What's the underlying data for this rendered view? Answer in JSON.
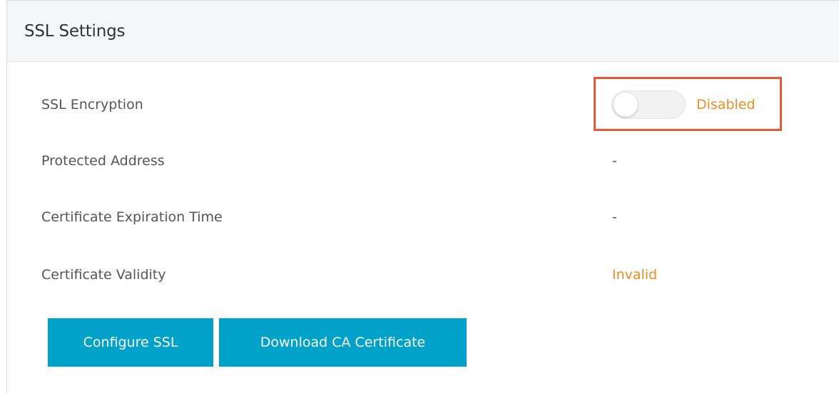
{
  "panel": {
    "title": "SSL Settings"
  },
  "rows": [
    {
      "label": "SSL Encryption",
      "value": "Disabled",
      "control": "toggle",
      "toggle_on": false
    },
    {
      "label": "Protected Address",
      "value": "-"
    },
    {
      "label": "Certificate Expiration Time",
      "value": "-"
    },
    {
      "label": "Certificate Validity",
      "value": "Invalid"
    }
  ],
  "buttons": {
    "configure_label": "Configure SSL",
    "download_label": "Download CA Certificate"
  },
  "colors": {
    "accent": "#00a2ca",
    "warning": "#f48b1f",
    "highlight": "#e8573a",
    "header_bg": "#f5f6f8"
  }
}
